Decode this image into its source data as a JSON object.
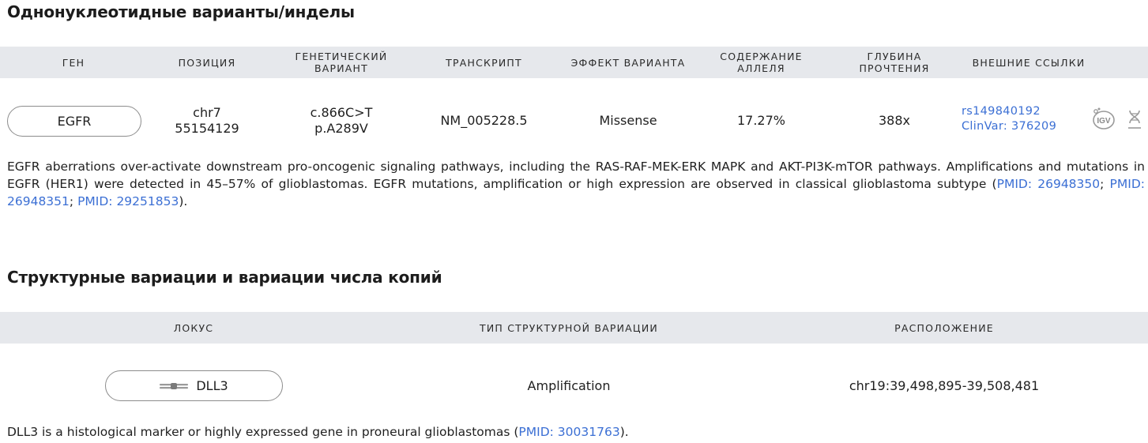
{
  "snv": {
    "title": "Однонуклеотидные варианты/инделы",
    "headers": {
      "gene": "ГЕН",
      "position": "ПОЗИЦИЯ",
      "variant": "ГЕНЕТИЧЕСКИЙ\nВАРИАНТ",
      "transcript": "ТРАНСКРИПТ",
      "effect": "ЭФФЕКТ ВАРИАНТА",
      "allele": "СОДЕРЖАНИЕ\nАЛЛЕЛЯ",
      "depth": "ГЛУБИНА\nПРОЧТЕНИЯ",
      "links": "ВНЕШНИЕ ССЫЛКИ"
    },
    "row": {
      "gene": "EGFR",
      "position": "chr7\n55154129",
      "variant": "c.866C>T\np.A289V",
      "transcript": "NM_005228.5",
      "effect": "Missense",
      "allele": "17.27%",
      "depth": "388x",
      "link_rs": "rs149840192",
      "link_clinvar": "ClinVar: 376209",
      "igv_icon": "igv-icon",
      "dna_icon": "dna-icon"
    },
    "description": {
      "text": "EGFR aberrations over-activate downstream pro-oncogenic signaling pathways, including the RAS-RAF-MEK-ERK MAPK and AKT-PI3K-mTOR pathways. Amplifications and mutations in EGFR (HER1) were detected in 45–57% of glioblastomas. EGFR mutations, amplification or high expression are observed in classical glioblastoma subtype (",
      "pmid1": "PMID: 26948350",
      "sep1": "; ",
      "pmid2": "PMID: 26948351",
      "sep2": "; ",
      "pmid3": "PMID: 29251853",
      "end": ")."
    }
  },
  "cnv": {
    "title": "Структурные вариации и вариации числа копий",
    "headers": {
      "locus": "ЛОКУС",
      "type": "ТИП СТРУКТУРНОЙ ВАРИАЦИИ",
      "location": "РАСПОЛОЖЕНИЕ"
    },
    "row": {
      "locus": "DLL3",
      "locus_icon": "chromosome-icon",
      "type": "Amplification",
      "location": "chr19:39,498,895-39,508,481"
    },
    "description": {
      "text": "DLL3 is a histological marker or highly expressed gene in proneural glioblastomas (",
      "pmid": "PMID: 30031763",
      "end": ")."
    }
  },
  "colors": {
    "header_bg": "#e6e8ec",
    "link": "#3b6fd4",
    "pill_border": "#8c8c8c"
  }
}
